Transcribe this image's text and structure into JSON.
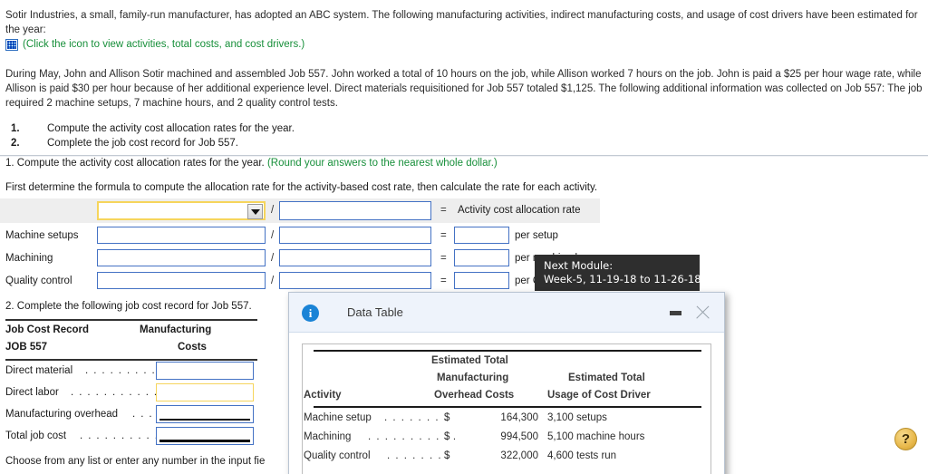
{
  "problem": {
    "paragraph1": "Sotir Industries, a small, family-run manufacturer, has adopted an ABC system. The following manufacturing activities, indirect manufacturing costs, and usage of cost drivers have been estimated for the year:",
    "icon_link_text": "(Click the icon to view activities, total costs, and cost drivers.)",
    "icon_name": "data-table-grid-icon",
    "paragraph2": "During May, John and Allison Sotir machined and assembled Job 557. John worked a total of 10 hours on the job, while Allison worked 7 hours on the job. John is paid a $25 per hour wage rate, while Allison is paid $30 per hour because of her additional experience level. Direct materials requisitioned for Job 557 totaled $1,125. The following additional information was collected on Job 557: The job required 2 machine setups, 7 machine hours, and 2 quality control tests.",
    "requirements": [
      {
        "num": "1.",
        "text": "Compute the activity cost allocation rates for the year."
      },
      {
        "num": "2.",
        "text": "Complete the job cost record for Job 557."
      }
    ]
  },
  "part1": {
    "heading_main": "1. Compute the activity cost allocation rates for the year.",
    "heading_note": "(Round your answers to the nearest whole dollar.)",
    "instruction": "First determine the formula to compute the allocation rate for the activity-based cost rate, then calculate the rate for each activity.",
    "header_row": {
      "dropdown_value": "",
      "dropdown_placeholder": "",
      "slash": "/",
      "numerator_value": "",
      "equals": "=",
      "result_label": "Activity cost allocation rate"
    },
    "rows": [
      {
        "label": "Machine setups",
        "numerator": "",
        "slash": "/",
        "denominator": "",
        "equals": "=",
        "rate": "",
        "suffix": "per setup"
      },
      {
        "label": "Machining",
        "numerator": "",
        "slash": "/",
        "denominator": "",
        "equals": "=",
        "rate": "",
        "suffix": "per machine hour"
      },
      {
        "label": "Quality control",
        "numerator": "",
        "slash": "/",
        "denominator": "",
        "equals": "=",
        "rate": "",
        "suffix": "per QC test"
      }
    ]
  },
  "part2": {
    "heading": "2. Complete the following job cost record for Job 557.",
    "table_header": {
      "left_line1": "Job Cost Record",
      "left_line2": "JOB 557",
      "right_line1": "Manufacturing",
      "right_line2": "Costs"
    },
    "rows": [
      {
        "label": "Direct material",
        "dots": ". . . . . . . . . .",
        "value": ""
      },
      {
        "label": "Direct labor",
        "dots": ". . . . . . . . . . . .",
        "value": ""
      },
      {
        "label": "Manufacturing overhead",
        "dots": ". . .",
        "value": ""
      },
      {
        "label": "Total job cost",
        "dots": ". . . . . . . . . . .",
        "value": ""
      }
    ],
    "bottom_note": "Choose from any list or enter any number in the input fie"
  },
  "tooltip": {
    "line1": "Next Module:",
    "line2": "Week-5, 11-19-18 to 11-26-18"
  },
  "dialog": {
    "title": "Data Table",
    "info_icon_glyph": "i",
    "minimize_label": "minimize",
    "close_label": "close",
    "table": {
      "header_group_top": "Estimated Total",
      "col1_header": "Activity",
      "col2_header_line1": "Manufacturing",
      "col2_header_line2": "Overhead Costs",
      "col3_header_line1": "Estimated Total",
      "col3_header_line2": "Usage of Cost Driver",
      "rows": [
        {
          "activity": "Machine setup",
          "dots": ". . . . . . . .",
          "currency": "$",
          "cost": "164,300",
          "driver": "3,100 setups"
        },
        {
          "activity": "Machining",
          "dots": ". . . . . . . . . . .",
          "currency": "$",
          "cost": "994,500",
          "driver": "5,100 machine hours"
        },
        {
          "activity": "Quality control",
          "dots": ". . . . . . . .",
          "currency": "$",
          "cost": "322,000",
          "driver": "4,600 tests run"
        }
      ]
    }
  },
  "help": {
    "label": "?",
    "icon_name": "help-question-icon"
  },
  "colors": {
    "input_border": "#4472c4",
    "focus_border": "#f6d55c",
    "green_text": "#178f3a",
    "dialog_header": "#eef3fb",
    "info_blue": "#1a83d6",
    "help_gold": "#e8b84b"
  }
}
